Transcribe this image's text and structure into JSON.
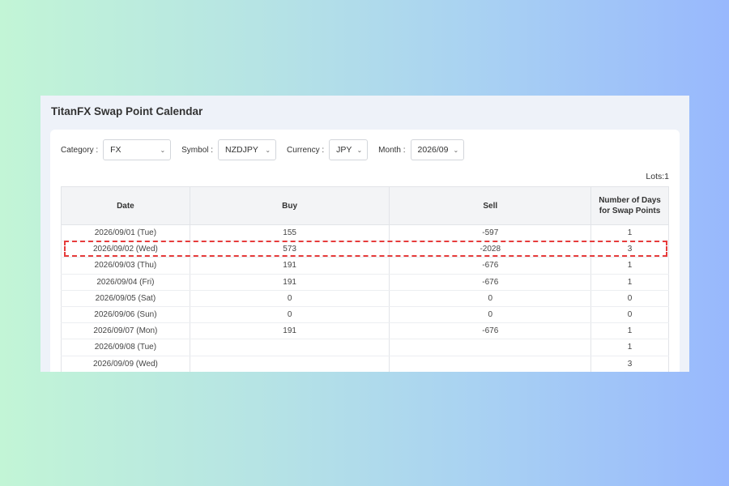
{
  "app": {
    "title": "TitanFX Swap Point Calendar"
  },
  "filters": {
    "category": {
      "label": "Category :",
      "value": "FX"
    },
    "symbol": {
      "label": "Symbol :",
      "value": "NZDJPY"
    },
    "currency": {
      "label": "Currency :",
      "value": "JPY"
    },
    "month": {
      "label": "Month :",
      "value": "2026/09"
    }
  },
  "lots": "Lots:1",
  "table": {
    "headers": {
      "date": "Date",
      "buy": "Buy",
      "sell": "Sell",
      "days": "Number of Days for Swap Points"
    },
    "rows": [
      {
        "date": "2026/09/01 (Tue)",
        "buy": "155",
        "sell": "-597",
        "days": "1"
      },
      {
        "date": "2026/09/02 (Wed)",
        "buy": "573",
        "sell": "-2028",
        "days": "3"
      },
      {
        "date": "2026/09/03 (Thu)",
        "buy": "191",
        "sell": "-676",
        "days": "1"
      },
      {
        "date": "2026/09/04 (Fri)",
        "buy": "191",
        "sell": "-676",
        "days": "1"
      },
      {
        "date": "2026/09/05 (Sat)",
        "buy": "0",
        "sell": "0",
        "days": "0"
      },
      {
        "date": "2026/09/06 (Sun)",
        "buy": "0",
        "sell": "0",
        "days": "0"
      },
      {
        "date": "2026/09/07 (Mon)",
        "buy": "191",
        "sell": "-676",
        "days": "1"
      },
      {
        "date": "2026/09/08 (Tue)",
        "buy": "",
        "sell": "",
        "days": "1"
      },
      {
        "date": "2026/09/09 (Wed)",
        "buy": "",
        "sell": "",
        "days": "3"
      }
    ]
  },
  "colors": {
    "highlight": "#e63b3b"
  }
}
